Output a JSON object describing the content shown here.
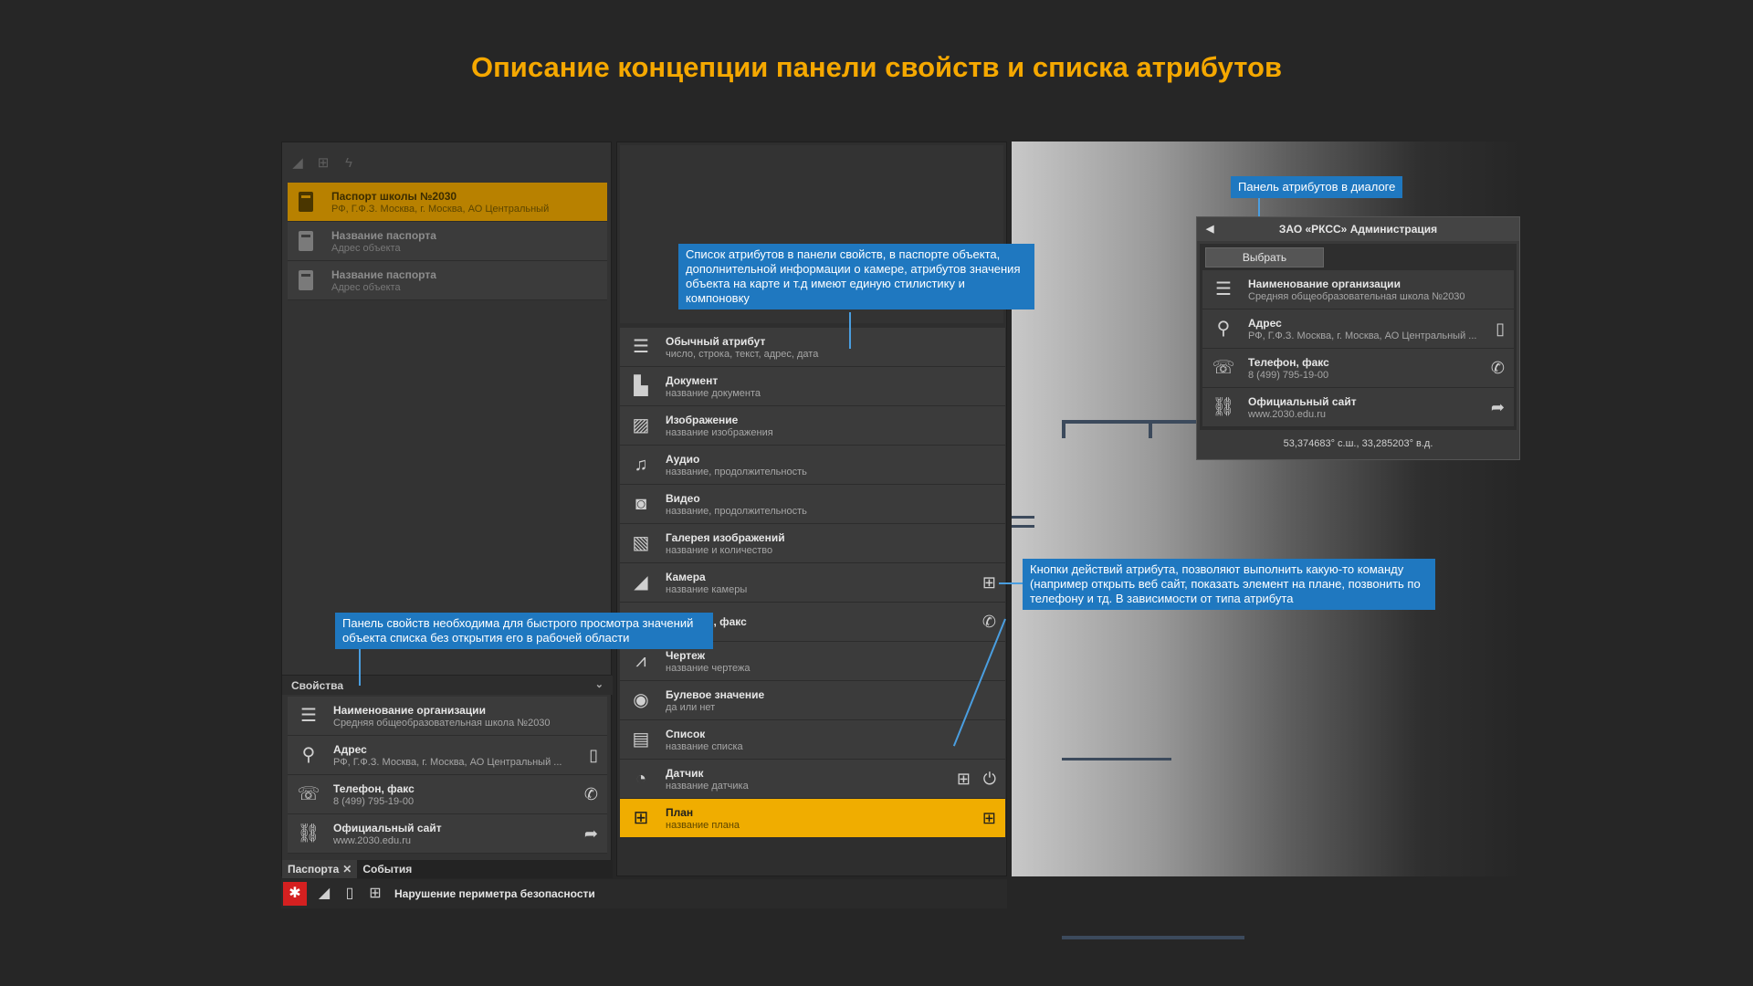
{
  "title": "Описание концепции панели свойств и списка атрибутов",
  "colors": {
    "accent": "#f5a800",
    "callout": "#1f78c0",
    "alarm": "#d42020"
  },
  "left_panel": {
    "toolbar_icons": [
      "camera-icon",
      "plan-icon",
      "lightning-icon"
    ],
    "passports": [
      {
        "title": "Паспорт школы №2030",
        "sub": "РФ, Г.Ф.З. Москва, г. Москва, АО Центральный"
      },
      {
        "title": "Название паспорта",
        "sub": "Адрес объекта"
      },
      {
        "title": "Название паспорта",
        "sub": "Адрес объекта"
      }
    ],
    "props_header": "Свойства",
    "props": [
      {
        "title": "Наименование организации",
        "sub": "Средняя общеобразовательная школа №2030",
        "icon": "text-lines-icon"
      },
      {
        "title": "Адрес",
        "sub": "РФ, Г.Ф.З. Москва, г. Москва, АО Центральный ...",
        "icon": "pin-icon",
        "action": "map-icon"
      },
      {
        "title": "Телефон, факс",
        "sub": "8 (499) 795-19-00",
        "icon": "fax-icon",
        "action": "phone-icon"
      },
      {
        "title": "Официальный сайт",
        "sub": "www.2030.edu.ru",
        "icon": "link-icon",
        "action": "share-icon"
      }
    ],
    "tabs": [
      {
        "label": "Паспорта"
      },
      {
        "label": "События"
      }
    ]
  },
  "attributes": [
    {
      "title": "Обычный атрибут",
      "sub": "число, строка, текст, адрес, дата",
      "icon": "text-lines-icon"
    },
    {
      "title": "Документ",
      "sub": "название документа",
      "icon": "document-icon"
    },
    {
      "title": "Изображение",
      "sub": "название изображения",
      "icon": "image-icon"
    },
    {
      "title": "Аудио",
      "sub": "название, продолжительность",
      "icon": "music-icon"
    },
    {
      "title": "Видео",
      "sub": "название, продолжительность",
      "icon": "video-icon"
    },
    {
      "title": "Галерея изображений",
      "sub": "название и количество",
      "icon": "gallery-icon"
    },
    {
      "title": "Камера",
      "sub": "название камеры",
      "icon": "camera-icon",
      "action": "plan-icon"
    },
    {
      "title": "Телефон, факс",
      "sub": "",
      "icon": "fax-icon",
      "action": "phone-icon"
    },
    {
      "title": "Чертеж",
      "sub": "название чертежа",
      "icon": "compass-icon"
    },
    {
      "title": "Булевое значение",
      "sub": "да или нет",
      "icon": "toggle-icon"
    },
    {
      "title": "Список",
      "sub": "название списка",
      "icon": "list-icon"
    },
    {
      "title": "Датчик",
      "sub": "название датчика",
      "icon": "sensor-icon",
      "action": "plan-icon",
      "action2": "power-icon"
    },
    {
      "title": "План",
      "sub": "название плана",
      "icon": "plan-icon",
      "action": "plan-icon",
      "active": true
    }
  ],
  "bottom_bar": {
    "text": "Нарушение периметра безопасности"
  },
  "dialog": {
    "header": "ЗАО «РКСС» Администрация",
    "button": "Выбрать",
    "items": [
      {
        "title": "Наименование организации",
        "sub": "Средняя общеобразовательная школа №2030",
        "icon": "text-lines-icon"
      },
      {
        "title": "Адрес",
        "sub": "РФ, Г.Ф.З. Москва, г. Москва, АО Центральный ...",
        "icon": "pin-icon",
        "action": "map-icon"
      },
      {
        "title": "Телефон, факс",
        "sub": "8 (499) 795-19-00",
        "icon": "fax-icon",
        "action": "phone-icon"
      },
      {
        "title": "Официальный сайт",
        "sub": "www.2030.edu.ru",
        "icon": "link-icon",
        "action": "share-icon"
      }
    ],
    "coords": "53,374683° с.ш., 33,285203° в.д."
  },
  "callouts": {
    "dialog_label": "Панель атрибутов в диалоге",
    "attr_list": "Список атрибутов в панели свойств, в паспорте объекта, дополнительной информации о камере, атрибутов значения объекта на карте и т.д имеют единую стилистику и компоновку",
    "actions": "Кнопки действий атрибута, позволяют выполнить какую-то команду (например открыть веб сайт, показать элемент на плане, позвонить по телефону и тд. В зависимости от типа атрибута",
    "props": "Панель свойств необходима для быстрого просмотра значений объекта списка без открытия его в рабочей области"
  }
}
